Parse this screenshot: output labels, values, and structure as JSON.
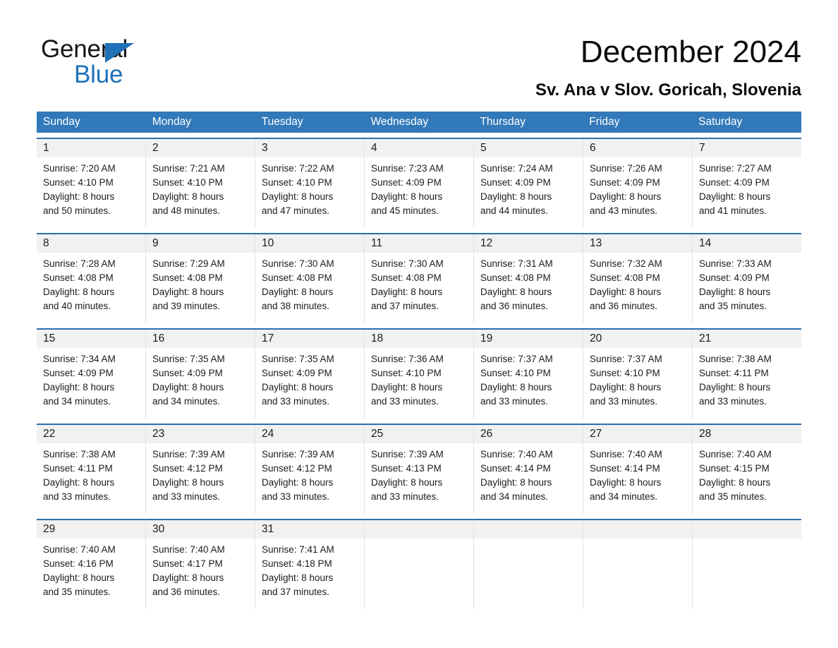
{
  "brand": {
    "name_part1": "General",
    "name_part2": "Blue",
    "triangle_icon": "triangle-logo-icon",
    "accent_color": "#1F71B8"
  },
  "header": {
    "title": "December 2024",
    "subtitle": "Sv. Ana v Slov. Goricah, Slovenia"
  },
  "colors": {
    "header_row_blue": "#3279B9",
    "week_rule_blue": "#2E6FAE",
    "day_band_gray": "#f1f1f1"
  },
  "weekdays": [
    {
      "label": "Sunday"
    },
    {
      "label": "Monday"
    },
    {
      "label": "Tuesday"
    },
    {
      "label": "Wednesday"
    },
    {
      "label": "Thursday"
    },
    {
      "label": "Friday"
    },
    {
      "label": "Saturday"
    }
  ],
  "weeks": [
    {
      "days": [
        {
          "num": "1",
          "sunrise": "Sunrise: 7:20 AM",
          "sunset": "Sunset: 4:10 PM",
          "daylight_line1": "Daylight: 8 hours",
          "daylight_line2": "and 50 minutes."
        },
        {
          "num": "2",
          "sunrise": "Sunrise: 7:21 AM",
          "sunset": "Sunset: 4:10 PM",
          "daylight_line1": "Daylight: 8 hours",
          "daylight_line2": "and 48 minutes."
        },
        {
          "num": "3",
          "sunrise": "Sunrise: 7:22 AM",
          "sunset": "Sunset: 4:10 PM",
          "daylight_line1": "Daylight: 8 hours",
          "daylight_line2": "and 47 minutes."
        },
        {
          "num": "4",
          "sunrise": "Sunrise: 7:23 AM",
          "sunset": "Sunset: 4:09 PM",
          "daylight_line1": "Daylight: 8 hours",
          "daylight_line2": "and 45 minutes."
        },
        {
          "num": "5",
          "sunrise": "Sunrise: 7:24 AM",
          "sunset": "Sunset: 4:09 PM",
          "daylight_line1": "Daylight: 8 hours",
          "daylight_line2": "and 44 minutes."
        },
        {
          "num": "6",
          "sunrise": "Sunrise: 7:26 AM",
          "sunset": "Sunset: 4:09 PM",
          "daylight_line1": "Daylight: 8 hours",
          "daylight_line2": "and 43 minutes."
        },
        {
          "num": "7",
          "sunrise": "Sunrise: 7:27 AM",
          "sunset": "Sunset: 4:09 PM",
          "daylight_line1": "Daylight: 8 hours",
          "daylight_line2": "and 41 minutes."
        }
      ]
    },
    {
      "days": [
        {
          "num": "8",
          "sunrise": "Sunrise: 7:28 AM",
          "sunset": "Sunset: 4:08 PM",
          "daylight_line1": "Daylight: 8 hours",
          "daylight_line2": "and 40 minutes."
        },
        {
          "num": "9",
          "sunrise": "Sunrise: 7:29 AM",
          "sunset": "Sunset: 4:08 PM",
          "daylight_line1": "Daylight: 8 hours",
          "daylight_line2": "and 39 minutes."
        },
        {
          "num": "10",
          "sunrise": "Sunrise: 7:30 AM",
          "sunset": "Sunset: 4:08 PM",
          "daylight_line1": "Daylight: 8 hours",
          "daylight_line2": "and 38 minutes."
        },
        {
          "num": "11",
          "sunrise": "Sunrise: 7:30 AM",
          "sunset": "Sunset: 4:08 PM",
          "daylight_line1": "Daylight: 8 hours",
          "daylight_line2": "and 37 minutes."
        },
        {
          "num": "12",
          "sunrise": "Sunrise: 7:31 AM",
          "sunset": "Sunset: 4:08 PM",
          "daylight_line1": "Daylight: 8 hours",
          "daylight_line2": "and 36 minutes."
        },
        {
          "num": "13",
          "sunrise": "Sunrise: 7:32 AM",
          "sunset": "Sunset: 4:08 PM",
          "daylight_line1": "Daylight: 8 hours",
          "daylight_line2": "and 36 minutes."
        },
        {
          "num": "14",
          "sunrise": "Sunrise: 7:33 AM",
          "sunset": "Sunset: 4:09 PM",
          "daylight_line1": "Daylight: 8 hours",
          "daylight_line2": "and 35 minutes."
        }
      ]
    },
    {
      "days": [
        {
          "num": "15",
          "sunrise": "Sunrise: 7:34 AM",
          "sunset": "Sunset: 4:09 PM",
          "daylight_line1": "Daylight: 8 hours",
          "daylight_line2": "and 34 minutes."
        },
        {
          "num": "16",
          "sunrise": "Sunrise: 7:35 AM",
          "sunset": "Sunset: 4:09 PM",
          "daylight_line1": "Daylight: 8 hours",
          "daylight_line2": "and 34 minutes."
        },
        {
          "num": "17",
          "sunrise": "Sunrise: 7:35 AM",
          "sunset": "Sunset: 4:09 PM",
          "daylight_line1": "Daylight: 8 hours",
          "daylight_line2": "and 33 minutes."
        },
        {
          "num": "18",
          "sunrise": "Sunrise: 7:36 AM",
          "sunset": "Sunset: 4:10 PM",
          "daylight_line1": "Daylight: 8 hours",
          "daylight_line2": "and 33 minutes."
        },
        {
          "num": "19",
          "sunrise": "Sunrise: 7:37 AM",
          "sunset": "Sunset: 4:10 PM",
          "daylight_line1": "Daylight: 8 hours",
          "daylight_line2": "and 33 minutes."
        },
        {
          "num": "20",
          "sunrise": "Sunrise: 7:37 AM",
          "sunset": "Sunset: 4:10 PM",
          "daylight_line1": "Daylight: 8 hours",
          "daylight_line2": "and 33 minutes."
        },
        {
          "num": "21",
          "sunrise": "Sunrise: 7:38 AM",
          "sunset": "Sunset: 4:11 PM",
          "daylight_line1": "Daylight: 8 hours",
          "daylight_line2": "and 33 minutes."
        }
      ]
    },
    {
      "days": [
        {
          "num": "22",
          "sunrise": "Sunrise: 7:38 AM",
          "sunset": "Sunset: 4:11 PM",
          "daylight_line1": "Daylight: 8 hours",
          "daylight_line2": "and 33 minutes."
        },
        {
          "num": "23",
          "sunrise": "Sunrise: 7:39 AM",
          "sunset": "Sunset: 4:12 PM",
          "daylight_line1": "Daylight: 8 hours",
          "daylight_line2": "and 33 minutes."
        },
        {
          "num": "24",
          "sunrise": "Sunrise: 7:39 AM",
          "sunset": "Sunset: 4:12 PM",
          "daylight_line1": "Daylight: 8 hours",
          "daylight_line2": "and 33 minutes."
        },
        {
          "num": "25",
          "sunrise": "Sunrise: 7:39 AM",
          "sunset": "Sunset: 4:13 PM",
          "daylight_line1": "Daylight: 8 hours",
          "daylight_line2": "and 33 minutes."
        },
        {
          "num": "26",
          "sunrise": "Sunrise: 7:40 AM",
          "sunset": "Sunset: 4:14 PM",
          "daylight_line1": "Daylight: 8 hours",
          "daylight_line2": "and 34 minutes."
        },
        {
          "num": "27",
          "sunrise": "Sunrise: 7:40 AM",
          "sunset": "Sunset: 4:14 PM",
          "daylight_line1": "Daylight: 8 hours",
          "daylight_line2": "and 34 minutes."
        },
        {
          "num": "28",
          "sunrise": "Sunrise: 7:40 AM",
          "sunset": "Sunset: 4:15 PM",
          "daylight_line1": "Daylight: 8 hours",
          "daylight_line2": "and 35 minutes."
        }
      ]
    },
    {
      "days": [
        {
          "num": "29",
          "sunrise": "Sunrise: 7:40 AM",
          "sunset": "Sunset: 4:16 PM",
          "daylight_line1": "Daylight: 8 hours",
          "daylight_line2": "and 35 minutes."
        },
        {
          "num": "30",
          "sunrise": "Sunrise: 7:40 AM",
          "sunset": "Sunset: 4:17 PM",
          "daylight_line1": "Daylight: 8 hours",
          "daylight_line2": "and 36 minutes."
        },
        {
          "num": "31",
          "sunrise": "Sunrise: 7:41 AM",
          "sunset": "Sunset: 4:18 PM",
          "daylight_line1": "Daylight: 8 hours",
          "daylight_line2": "and 37 minutes."
        },
        {
          "num": "",
          "sunrise": "",
          "sunset": "",
          "daylight_line1": "",
          "daylight_line2": ""
        },
        {
          "num": "",
          "sunrise": "",
          "sunset": "",
          "daylight_line1": "",
          "daylight_line2": ""
        },
        {
          "num": "",
          "sunrise": "",
          "sunset": "",
          "daylight_line1": "",
          "daylight_line2": ""
        },
        {
          "num": "",
          "sunrise": "",
          "sunset": "",
          "daylight_line1": "",
          "daylight_line2": ""
        }
      ]
    }
  ]
}
